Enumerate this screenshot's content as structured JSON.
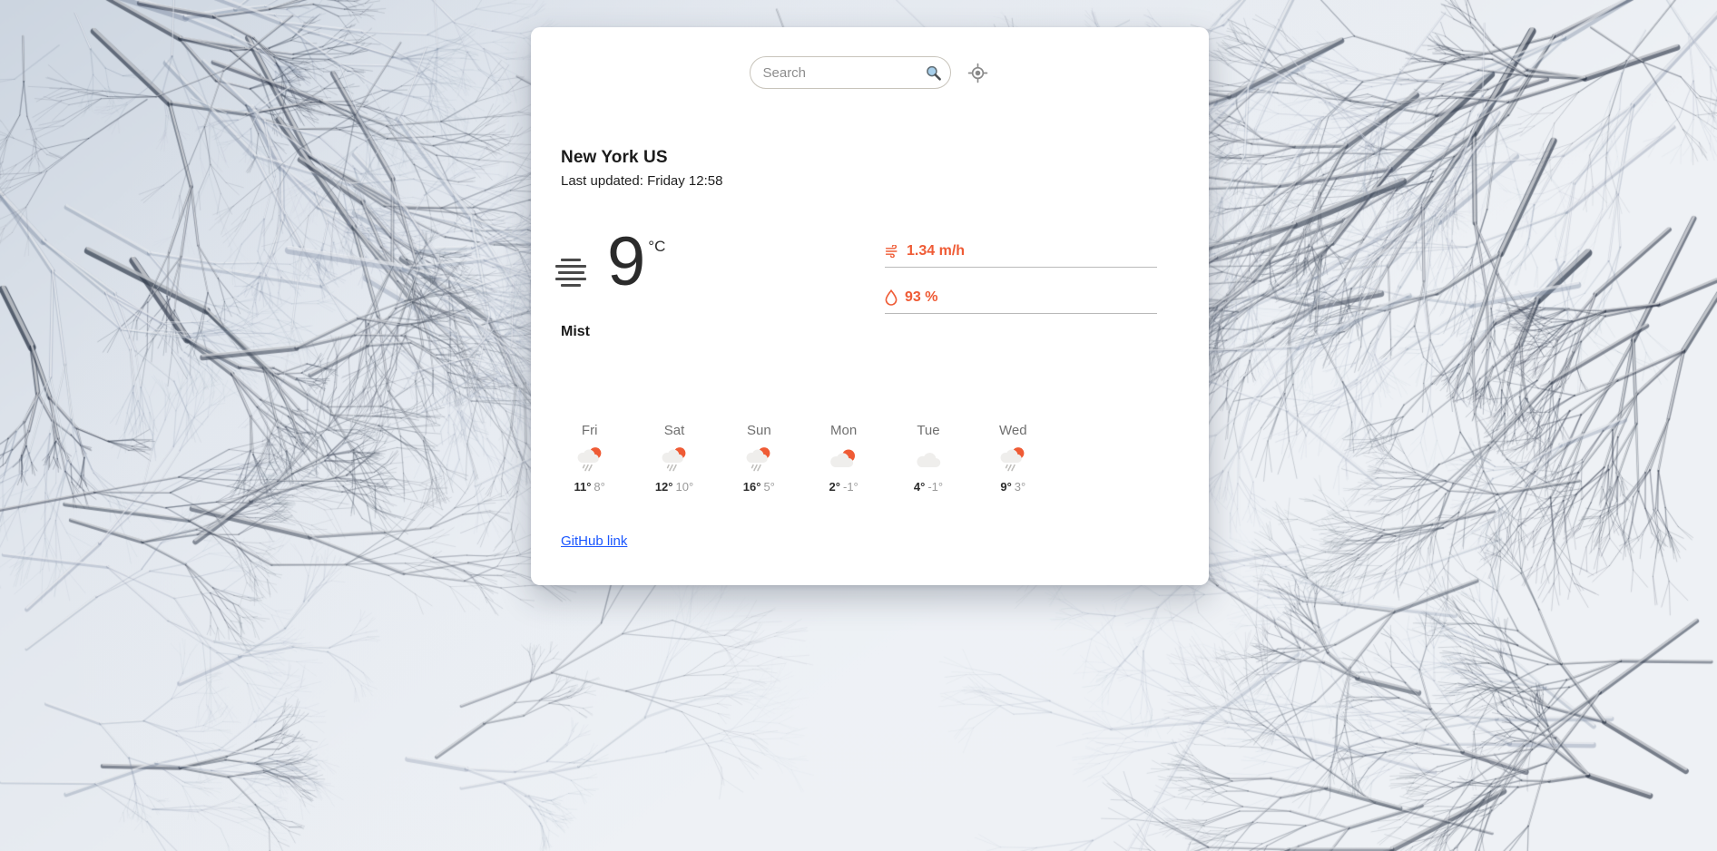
{
  "search": {
    "placeholder": "Search",
    "value": "",
    "search_icon": "magnifying-glass-icon",
    "locate_icon": "crosshair-location-icon"
  },
  "location": {
    "city": "New York US",
    "last_updated": "Last updated: Friday 12:58"
  },
  "current": {
    "icon": "mist-icon",
    "temperature": "9",
    "unit": "°C",
    "condition": "Mist",
    "metrics": [
      {
        "icon": "wind-icon",
        "glyph": "ඝ්",
        "value": "1.34 m/h",
        "accent": "#ef5b35"
      },
      {
        "icon": "humidity-droplet-icon",
        "glyph": "◇",
        "value": "93 %",
        "accent": "#ef5b35"
      }
    ]
  },
  "forecast": {
    "days": [
      {
        "name": "Fri",
        "icon": "sun-behind-rain-cloud-icon",
        "high": "11°",
        "low": "8°"
      },
      {
        "name": "Sat",
        "icon": "sun-behind-rain-cloud-icon",
        "high": "12°",
        "low": "10°"
      },
      {
        "name": "Sun",
        "icon": "sun-behind-rain-cloud-icon",
        "high": "16°",
        "low": "5°"
      },
      {
        "name": "Mon",
        "icon": "sun-behind-cloud-icon",
        "high": "2°",
        "low": "-1°"
      },
      {
        "name": "Tue",
        "icon": "cloud-icon",
        "high": "4°",
        "low": "-1°"
      },
      {
        "name": "Wed",
        "icon": "sun-behind-rain-cloud-icon",
        "high": "9°",
        "low": "3°"
      }
    ]
  },
  "footer": {
    "github_link": "GitHub link"
  },
  "colors": {
    "accent": "#ef5b35",
    "link": "#1a56ff",
    "card_bg": "#ffffff",
    "text": "#1b1b1b",
    "muted": "#9a9a9a"
  }
}
